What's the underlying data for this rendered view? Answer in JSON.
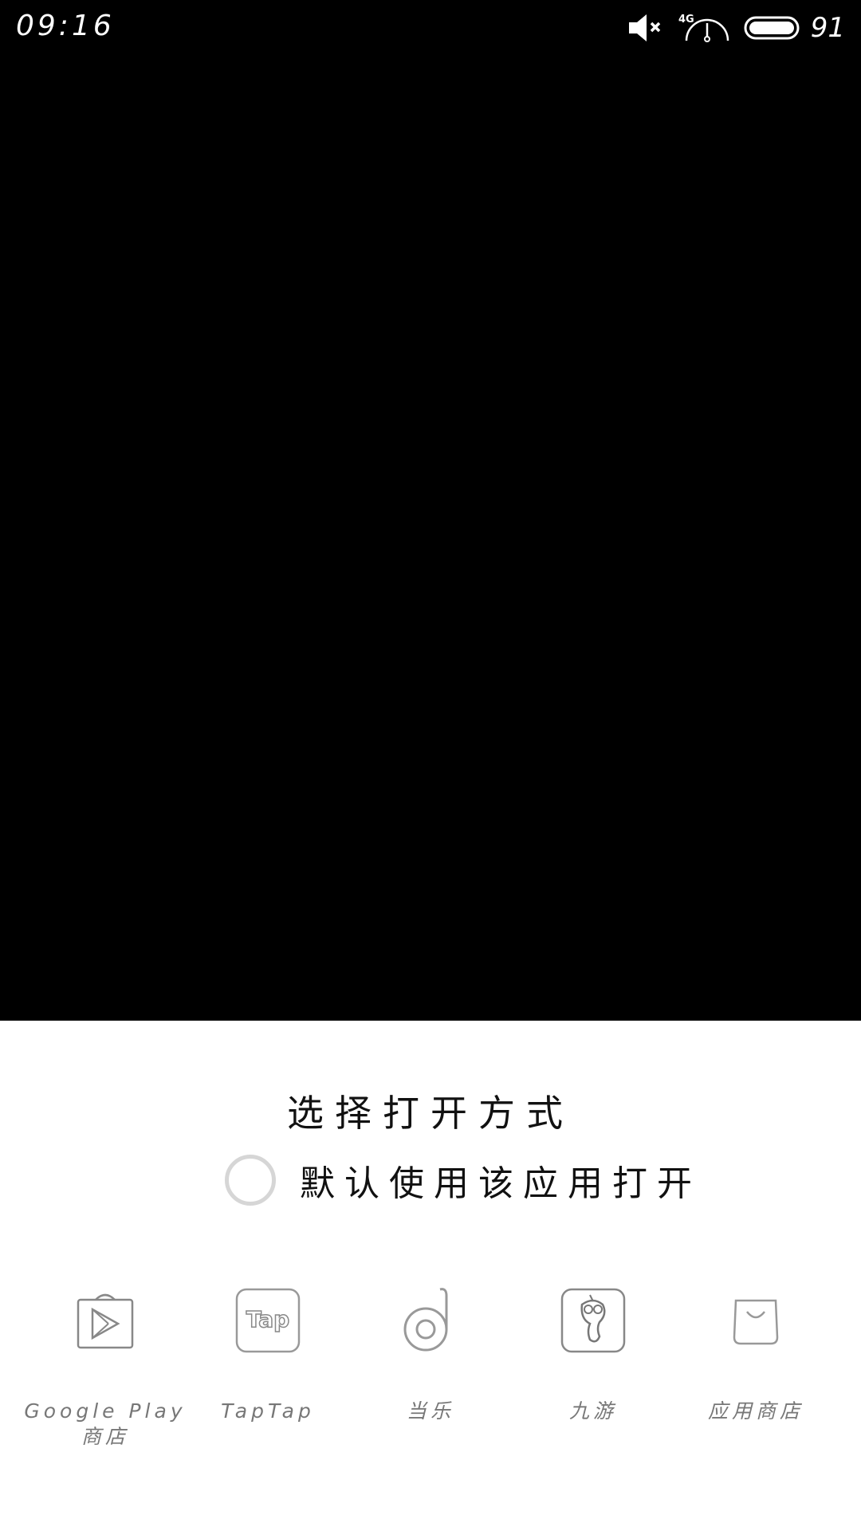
{
  "status_bar": {
    "time": "09:16",
    "network": "4G",
    "battery_percent": "91",
    "icons": [
      "mute-icon",
      "signal-icon",
      "battery-icon"
    ]
  },
  "sheet": {
    "title": "选择打开方式",
    "default_option_label": "默认使用该应用打开",
    "default_option_checked": false,
    "apps": [
      {
        "label": "Google Play\n商店",
        "icon": "google-play-icon"
      },
      {
        "label": "TapTap",
        "icon": "taptap-icon"
      },
      {
        "label": "当乐",
        "icon": "dangle-icon"
      },
      {
        "label": "九游",
        "icon": "jiuyou-icon"
      },
      {
        "label": "应用商店",
        "icon": "app-store-icon"
      }
    ]
  }
}
